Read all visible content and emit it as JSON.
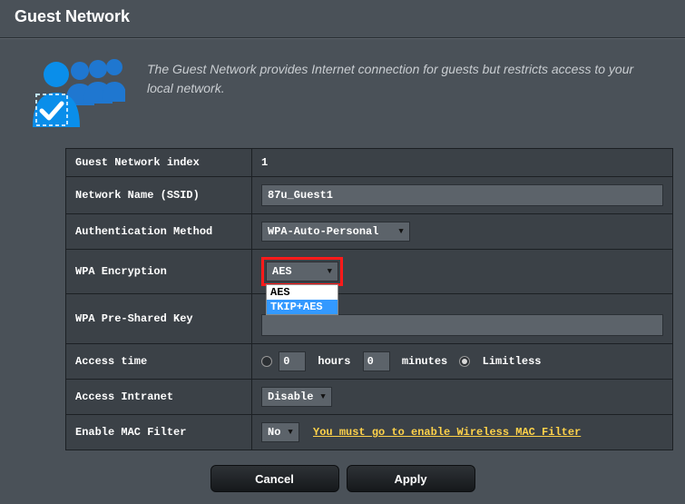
{
  "page_title": "Guest Network",
  "description": "The Guest Network provides Internet connection for guests but restricts access to your local network.",
  "rows": {
    "index": {
      "label": "Guest Network index",
      "value": "1"
    },
    "ssid": {
      "label": "Network Name (SSID)",
      "value": "87u_Guest1"
    },
    "auth": {
      "label": "Authentication Method",
      "value": "WPA-Auto-Personal"
    },
    "enc": {
      "label": "WPA Encryption",
      "value": "AES",
      "options": [
        "AES",
        "TKIP+AES"
      ],
      "highlighted_index": 1
    },
    "psk": {
      "label": "WPA Pre-Shared Key",
      "value": ""
    },
    "access": {
      "label": "Access time",
      "hours": "0",
      "minutes": "0",
      "hours_label": "hours",
      "minutes_label": "minutes",
      "limitless_label": "Limitless",
      "selected": "limitless"
    },
    "intranet": {
      "label": "Access Intranet",
      "value": "Disable"
    },
    "mac": {
      "label": "Enable MAC Filter",
      "value": "No",
      "link_text": "You must go to enable Wireless MAC Filter"
    }
  },
  "buttons": {
    "cancel": "Cancel",
    "apply": "Apply"
  }
}
